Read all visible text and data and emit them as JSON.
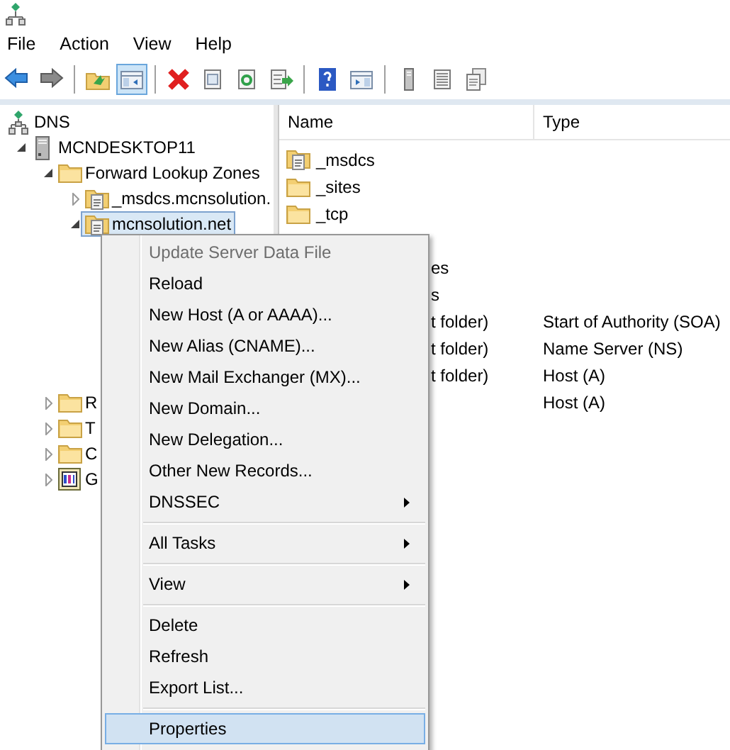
{
  "menu_bar": [
    "File",
    "Action",
    "View",
    "Help"
  ],
  "toolbar": [
    {
      "pressed": false
    },
    {
      "pressed": false
    },
    {
      "pressed": false
    },
    {
      "pressed": true
    },
    {
      "pressed": false
    },
    {
      "pressed": false
    },
    {
      "pressed": false
    },
    {
      "pressed": false
    },
    {
      "pressed": false
    },
    {
      "pressed": false
    },
    {
      "pressed": false
    },
    {
      "pressed": false
    },
    {
      "pressed": false
    }
  ],
  "tree": [
    {
      "kind": "root",
      "label": "DNS",
      "selected": false,
      "children": [
        {
          "kind": "server",
          "label": "MCNDESKTOP11",
          "expanded": true,
          "selected": false,
          "children": [
            {
              "kind": "folder",
              "label": "Forward Lookup Zones",
              "expanded": true,
              "selected": false,
              "children": [
                {
                  "kind": "zone",
                  "label": "_msdcs.mcnsolution.",
                  "expanded": false,
                  "selected": false
                },
                {
                  "kind": "zone",
                  "label": "mcnsolution.net",
                  "expanded": true,
                  "selected": true
                }
              ]
            },
            {
              "kind": "folder",
              "label": "R",
              "expanded": false,
              "selected": false
            },
            {
              "kind": "folder",
              "label": "T",
              "expanded": false,
              "selected": false
            },
            {
              "kind": "folder",
              "label": "C",
              "expanded": false,
              "selected": false
            },
            {
              "kind": "snapin",
              "label": "G",
              "expanded": false,
              "selected": false
            }
          ]
        }
      ]
    }
  ],
  "list": {
    "columns": [
      "Name",
      "Type"
    ],
    "rows": [
      {
        "kind": "zone",
        "name": "_msdcs"
      },
      {
        "kind": "folder",
        "name": "_sites"
      },
      {
        "kind": "folder",
        "name": "_tcp"
      },
      {
        "kind": "hidden"
      },
      {
        "kind": "partial",
        "name": "es"
      },
      {
        "kind": "partial",
        "name": "s"
      },
      {
        "kind": "partial",
        "name": "t folder)",
        "type": "Start of Authority (SOA)"
      },
      {
        "kind": "partial",
        "name": "t folder)",
        "type": "Name Server (NS)"
      },
      {
        "kind": "partial",
        "name": "t folder)",
        "type": "Host (A)"
      },
      {
        "kind": "hidden",
        "type": "Host (A)"
      }
    ]
  },
  "context_menu": [
    {
      "kind": "item",
      "label": "Update Server Data File",
      "disabled": true,
      "submenu": false,
      "selected": false
    },
    {
      "kind": "item",
      "label": "Reload",
      "disabled": false,
      "submenu": false,
      "selected": false
    },
    {
      "kind": "item",
      "label": "New Host (A or AAAA)...",
      "disabled": false,
      "submenu": false,
      "selected": false
    },
    {
      "kind": "item",
      "label": "New Alias (CNAME)...",
      "disabled": false,
      "submenu": false,
      "selected": false
    },
    {
      "kind": "item",
      "label": "New Mail Exchanger (MX)...",
      "disabled": false,
      "submenu": false,
      "selected": false
    },
    {
      "kind": "item",
      "label": "New Domain...",
      "disabled": false,
      "submenu": false,
      "selected": false
    },
    {
      "kind": "item",
      "label": "New Delegation...",
      "disabled": false,
      "submenu": false,
      "selected": false
    },
    {
      "kind": "item",
      "label": "Other New Records...",
      "disabled": false,
      "submenu": false,
      "selected": false
    },
    {
      "kind": "item",
      "label": "DNSSEC",
      "disabled": false,
      "submenu": true,
      "selected": false
    },
    {
      "kind": "separator"
    },
    {
      "kind": "item",
      "label": "All Tasks",
      "disabled": false,
      "submenu": true,
      "selected": false
    },
    {
      "kind": "separator"
    },
    {
      "kind": "item",
      "label": "View",
      "disabled": false,
      "submenu": true,
      "selected": false
    },
    {
      "kind": "separator"
    },
    {
      "kind": "item",
      "label": "Delete",
      "disabled": false,
      "submenu": false,
      "selected": false
    },
    {
      "kind": "item",
      "label": "Refresh",
      "disabled": false,
      "submenu": false,
      "selected": false
    },
    {
      "kind": "item",
      "label": "Export List...",
      "disabled": false,
      "submenu": false,
      "selected": false
    },
    {
      "kind": "separator"
    },
    {
      "kind": "item",
      "label": "Properties",
      "disabled": false,
      "submenu": false,
      "selected": true
    }
  ]
}
